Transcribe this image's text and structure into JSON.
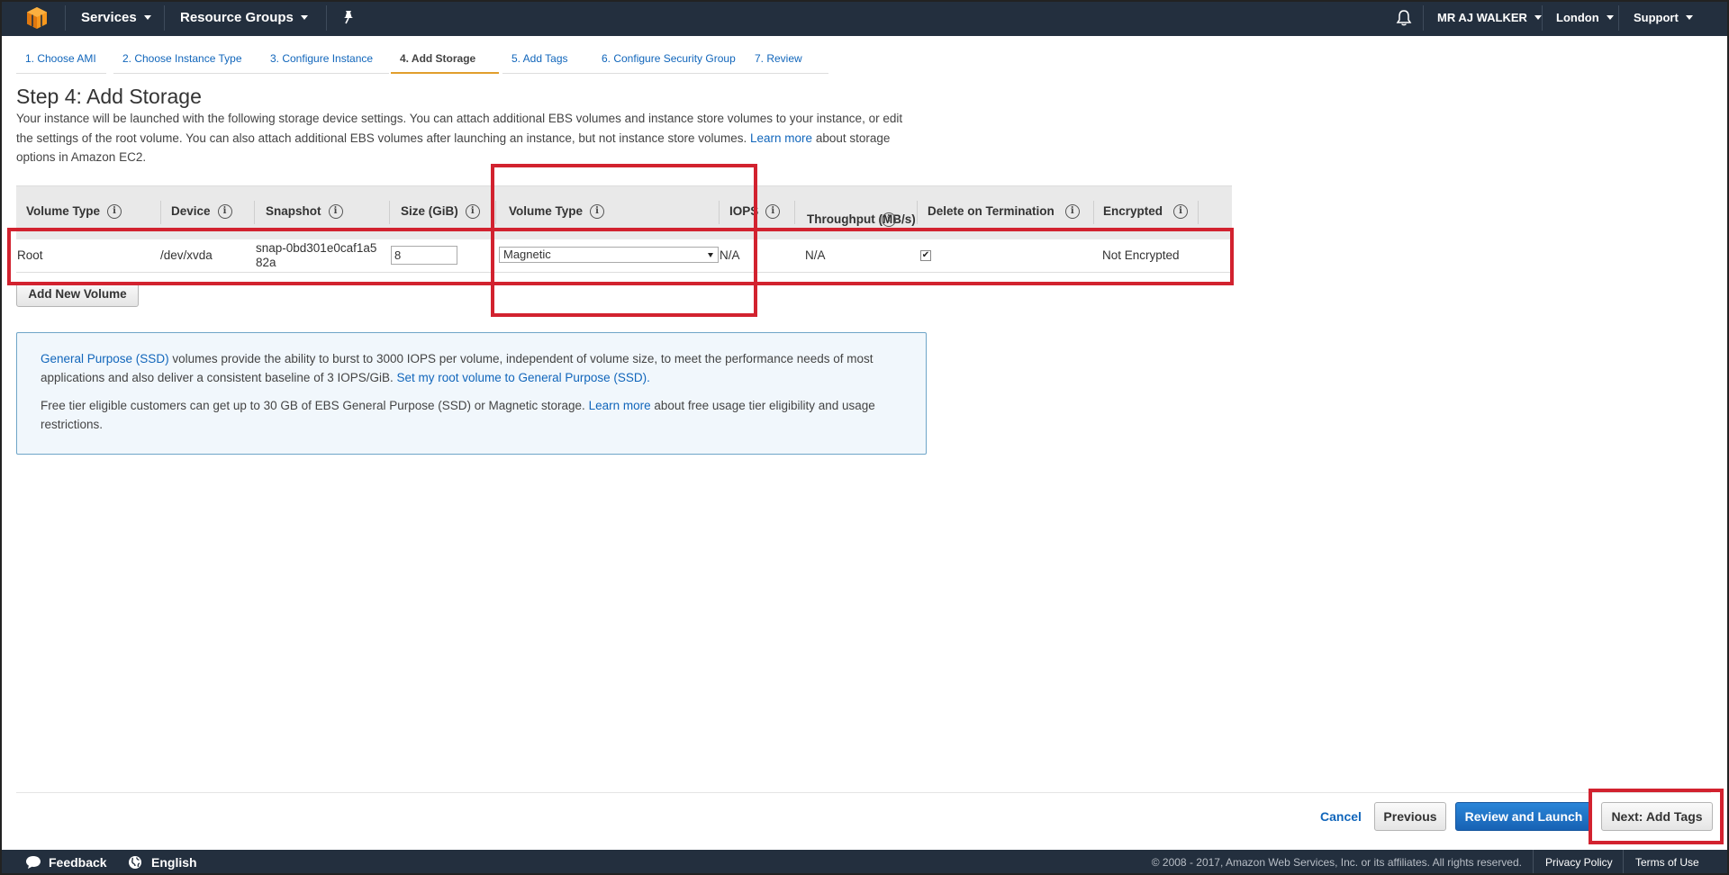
{
  "topbar": {
    "services": "Services",
    "resource_groups": "Resource Groups",
    "user": "MR AJ WALKER",
    "region": "London",
    "support": "Support",
    "logo_color": "#f7981d"
  },
  "tabs": [
    {
      "label": "1. Choose AMI"
    },
    {
      "label": "2. Choose Instance Type"
    },
    {
      "label": "3. Configure Instance"
    },
    {
      "label": "4. Add Storage"
    },
    {
      "label": "5. Add Tags"
    },
    {
      "label": "6. Configure Security Group"
    },
    {
      "label": "7. Review"
    }
  ],
  "page": {
    "title": "Step 4: Add Storage",
    "intro_before_link": "Your instance will be launched with the following storage device settings. You can attach additional EBS volumes and instance store volumes to your instance, or edit the settings of the root volume. You can also attach additional EBS volumes after launching an instance, but not instance store volumes.",
    "intro_link": "Learn more",
    "intro_after_link": "about storage options in Amazon EC2."
  },
  "table": {
    "headers": {
      "volume_type": "Volume Type",
      "device": "Device",
      "snapshot": "Snapshot",
      "size": "Size (GiB)",
      "volume_type2": "Volume Type",
      "iops": "IOPS",
      "throughput": "Throughput (MB/s)",
      "delete_on_termination": "Delete on Termination",
      "encrypted": "Encrypted"
    },
    "row": {
      "volume_type": "Root",
      "device": "/dev/xvda",
      "snapshot": "snap-0bd301e0caf1a582a",
      "size": "8",
      "volume_type_select": "Magnetic",
      "iops": "N/A",
      "throughput": "N/A",
      "delete_on_termination": true,
      "encrypted": "Not Encrypted"
    },
    "add_volume_label": "Add New Volume"
  },
  "info_box": {
    "p1_link": "General Purpose (SSD)",
    "p1_text": "volumes provide the ability to burst to 3000 IOPS per volume, independent of volume size, to meet the performance needs of most applications and also deliver a consistent baseline of 3 IOPS/GiB.",
    "p1_link2": "Set my root volume to General Purpose (SSD).",
    "p2_text": "Free tier eligible customers can get up to 30 GB of EBS General Purpose (SSD) or Magnetic storage.",
    "p2_link": "Learn more",
    "p2_after": "about free usage tier eligibility and usage restrictions."
  },
  "actions": {
    "cancel": "Cancel",
    "previous": "Previous",
    "review_launch": "Review and Launch",
    "next": "Next: Add Tags"
  },
  "bottombar": {
    "feedback": "Feedback",
    "language": "English",
    "copyright": "© 2008 - 2017, Amazon Web Services, Inc. or its affiliates. All rights reserved.",
    "privacy": "Privacy Policy",
    "terms": "Terms of Use"
  },
  "colors": {
    "nav_bg": "#232f3e",
    "highlight_red": "#d2222f",
    "active_tab_underline": "#e19e2c",
    "link_blue": "#1166bb",
    "primary_button": "#1762b4"
  }
}
